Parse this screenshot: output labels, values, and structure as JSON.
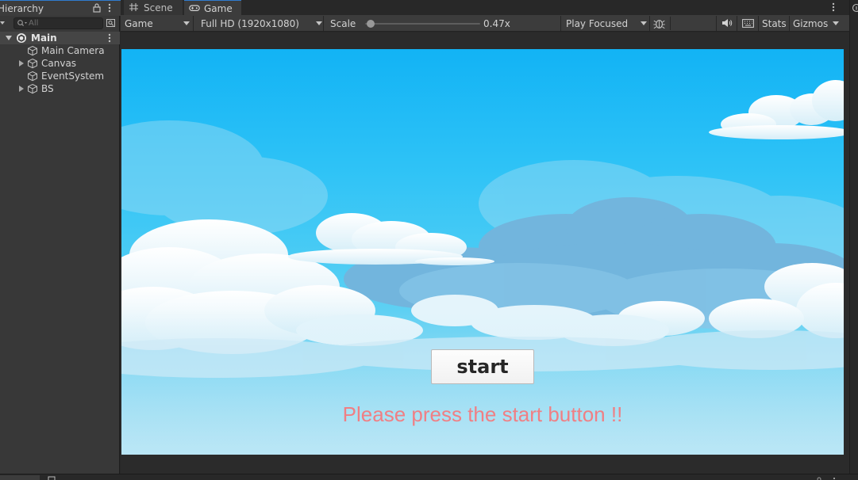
{
  "hierarchy": {
    "tab_label": "Hierarchy",
    "search_placeholder": "All",
    "scene": {
      "name": "Main"
    },
    "items": [
      {
        "label": "Main Camera",
        "has_children": false
      },
      {
        "label": "Canvas",
        "has_children": true
      },
      {
        "label": "EventSystem",
        "has_children": false
      },
      {
        "label": "BS",
        "has_children": true
      }
    ]
  },
  "tabs": [
    {
      "label": "Scene",
      "icon": "grid-icon",
      "active": false
    },
    {
      "label": "Game",
      "icon": "gamepad-icon",
      "active": true
    }
  ],
  "toolbar": {
    "display": "Game",
    "resolution": "Full HD (1920x1080)",
    "scale_label": "Scale",
    "scale_value": "0.47x",
    "scale_fraction": 0.05,
    "play_mode": "Play Focused",
    "stats_label": "Stats",
    "gizmos_label": "Gizmos"
  },
  "game": {
    "start_label": "start",
    "prompt": "Please press the start button !!"
  },
  "colors": {
    "accent_tab": "#2f7ccf",
    "prompt_text": "#f07f84",
    "sky_top": "#12b3f5",
    "sky_bottom": "#8fd6ef"
  }
}
